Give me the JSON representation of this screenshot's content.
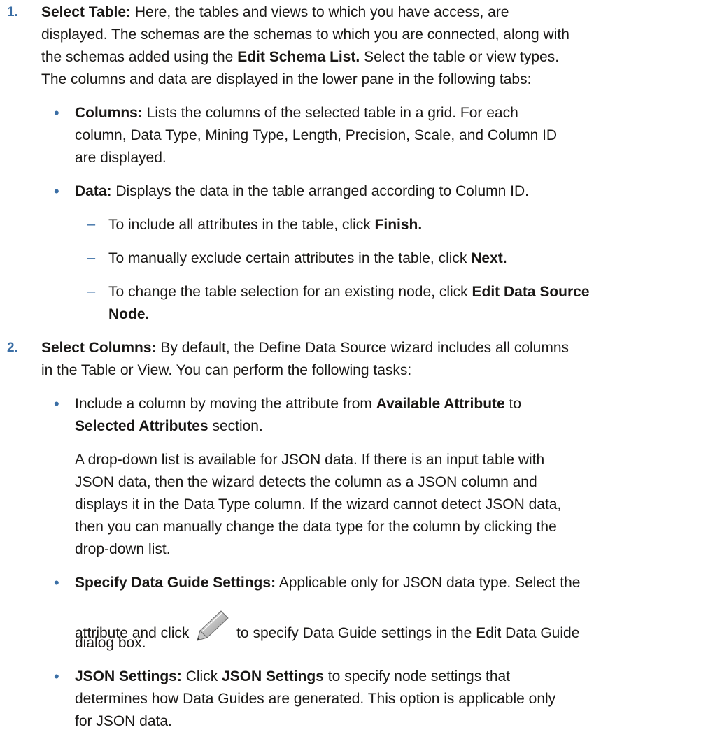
{
  "steps": [
    {
      "number": "1.",
      "term": "Select Table:",
      "lines": [
        "Here, the tables and views to which you have access, are",
        "displayed. The schemas are the schemas to which you are connected, along with",
        "the schemas added using the ",
        "Edit Schema List.",
        " Select the table or view types.",
        "The columns and data are displayed in the lower pane in the following tabs:"
      ],
      "bullets": [
        {
          "term": "Columns:",
          "line1": " Lists the columns of the selected table in a grid. For each",
          "line2": "column, Data Type, Mining Type, Length, Precision, Scale, and Column ID",
          "line3": "are displayed."
        },
        {
          "term": "Data:",
          "line1": " Displays the data in the table arranged according to Column ID.",
          "subitems": [
            {
              "text": "To include all attributes in the table, click ",
              "action": "Finish."
            },
            {
              "text": "To manually exclude certain attributes in the table, click ",
              "action": "Next."
            },
            {
              "text": "To change the table selection for an existing node, click ",
              "action": "Edit Data Source",
              "action2": "Node."
            }
          ]
        }
      ]
    },
    {
      "number": "2.",
      "term": "Select Columns:",
      "line1": " By default, the Define Data Source wizard includes all columns",
      "line2": "in the Table or View. You can perform the following tasks:",
      "bullets": [
        {
          "pre": "Include a column by moving the attribute from ",
          "b1": "Available Attribute",
          "mid": " to",
          "b2": "Selected Attributes",
          "post": " section.",
          "para": [
            "A drop-down list is available for JSON data. If there is an input table with",
            "JSON data, then the wizard detects the column as a JSON column and",
            "displays it in the Data Type column. If the wizard cannot detect JSON data,",
            "then you can manually change the data type for the column by clicking the",
            "drop-down list."
          ]
        },
        {
          "term": "Specify Data Guide Settings:",
          "line1": " Applicable only for JSON data type. Select the",
          "line2a": "attribute and click ",
          "line2b": " to specify Data Guide settings in the Edit Data Guide",
          "line3": "dialog box.",
          "icon": "pencil-icon"
        },
        {
          "term": "JSON Settings:",
          "pre": " Click ",
          "action": "JSON Settings",
          "line1": " to specify node settings that",
          "line2": "determines how Data Guides are generated. This option is applicable only",
          "line3": "for JSON data."
        }
      ]
    }
  ]
}
